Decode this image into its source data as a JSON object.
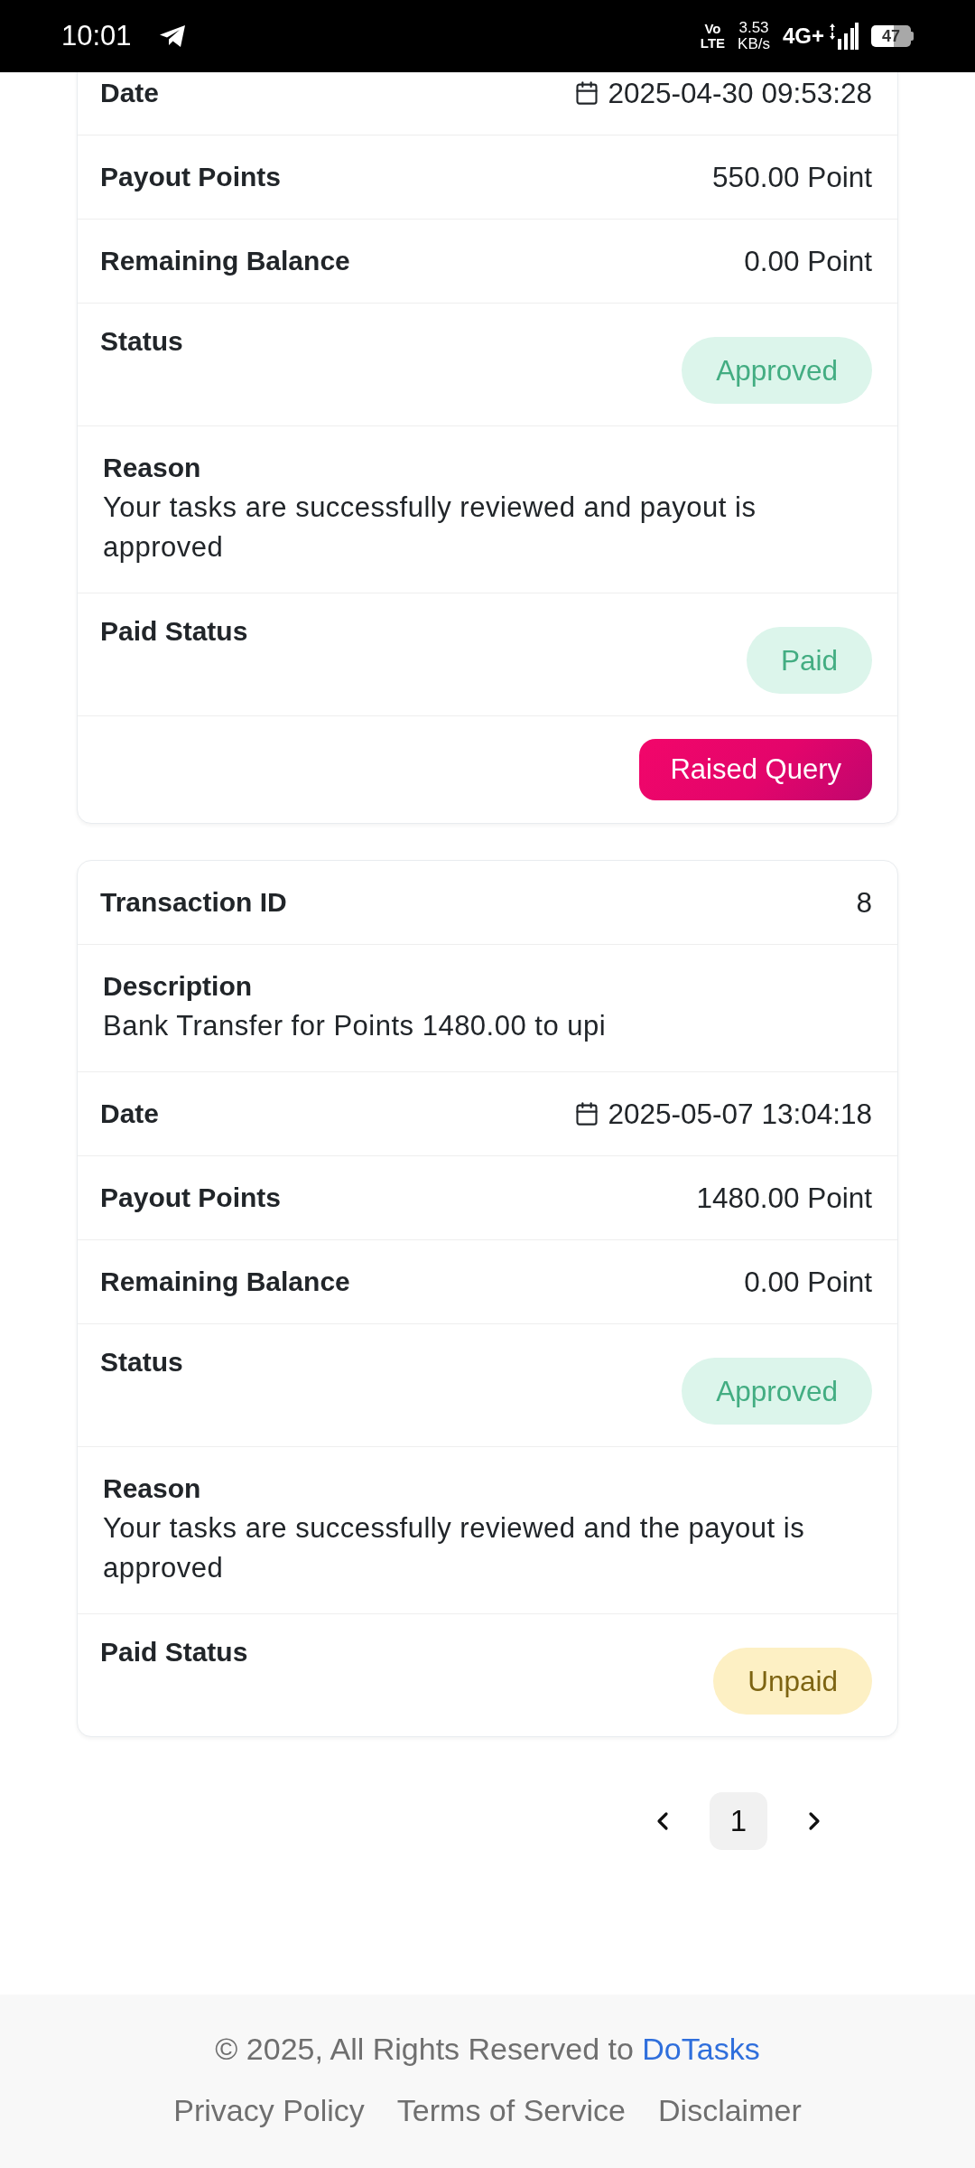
{
  "status_bar": {
    "time": "10:01",
    "volte": [
      "Vo",
      "LTE"
    ],
    "speed": "3.53",
    "speed_unit": "KB/s",
    "network": "4G+",
    "battery": "47"
  },
  "transactions": [
    {
      "rows": [
        {
          "kind": "date",
          "label": "Date",
          "value": "2025-04-30 09:53:28"
        },
        {
          "kind": "text",
          "label": "Payout Points",
          "value": "550.00 Point"
        },
        {
          "kind": "text",
          "label": "Remaining Balance",
          "value": "0.00 Point"
        },
        {
          "kind": "badge",
          "label": "Status",
          "value": "Approved",
          "color": "#dcf5eb"
        },
        {
          "kind": "block",
          "label": "Reason",
          "value": "Your tasks are successfully reviewed and payout is approved"
        },
        {
          "kind": "badge",
          "label": "Paid Status",
          "value": "Paid",
          "color": "#dcf5eb"
        }
      ],
      "action": "Raised Query"
    },
    {
      "rows": [
        {
          "kind": "text",
          "label": "Transaction ID",
          "value": "8"
        },
        {
          "kind": "block",
          "label": "Description",
          "value": "Bank Transfer for Points 1480.00 to upi"
        },
        {
          "kind": "date",
          "label": "Date",
          "value": "2025-05-07 13:04:18"
        },
        {
          "kind": "text",
          "label": "Payout Points",
          "value": "1480.00 Point"
        },
        {
          "kind": "text",
          "label": "Remaining Balance",
          "value": "0.00 Point"
        },
        {
          "kind": "badge",
          "label": "Status",
          "value": "Approved",
          "color": "#dcf5eb"
        },
        {
          "kind": "block",
          "label": "Reason",
          "value": "Your tasks are successfully reviewed and the payout is approved"
        },
        {
          "kind": "badge",
          "label": "Paid Status",
          "value": "Unpaid",
          "color": "#fdf0c4"
        }
      ]
    }
  ],
  "pagination": {
    "pages": [
      {
        "label": "1",
        "selected": true
      }
    ]
  },
  "footer": {
    "copyright": "© 2025, All Rights Reserved to",
    "brand": "DoTasks",
    "links": [
      "Privacy Policy",
      "Terms of Service",
      "Disclaimer"
    ]
  }
}
